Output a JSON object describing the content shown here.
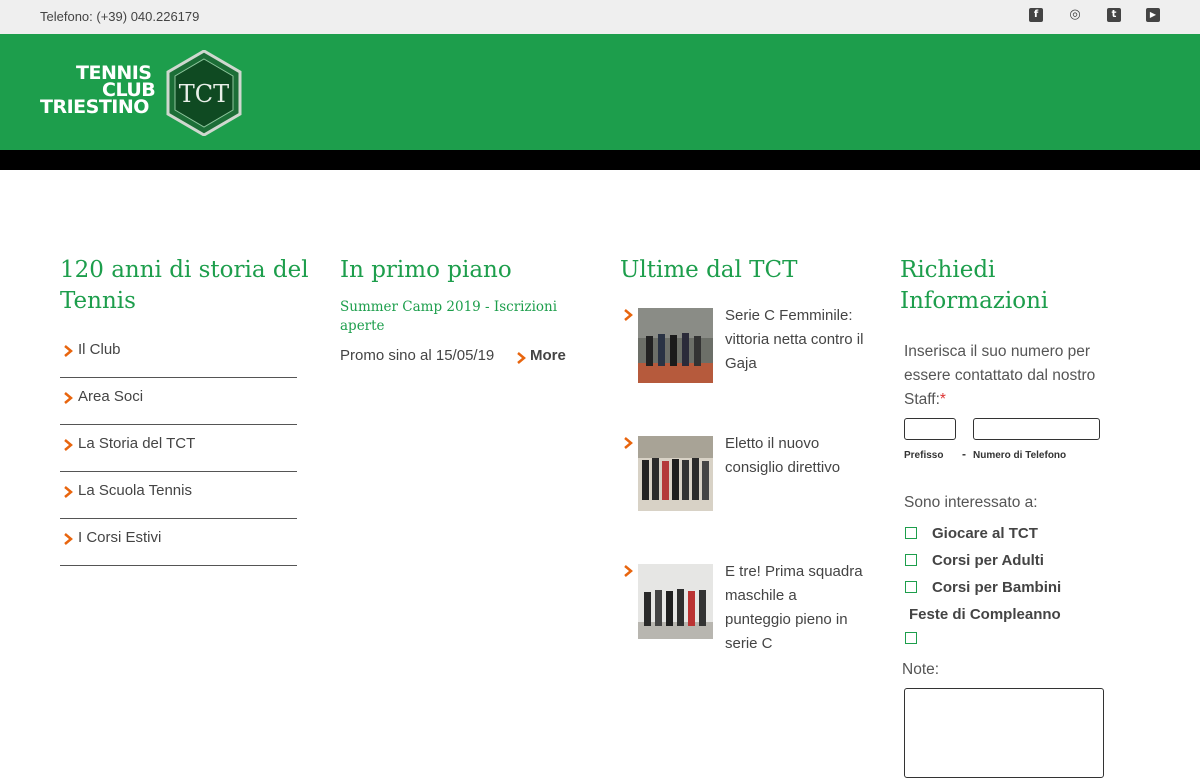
{
  "topbar": {
    "phone": "Telefono: (+39) 040.226179",
    "social": [
      {
        "icon": "facebook-icon",
        "glyph": "f"
      },
      {
        "icon": "instagram-icon",
        "glyph": "◎"
      },
      {
        "icon": "twitter-icon",
        "glyph": "t"
      },
      {
        "icon": "youtube-icon",
        "glyph": "▶"
      }
    ]
  },
  "header": {
    "logo_line1": "TENNIS",
    "logo_line2": "CLUB",
    "logo_line3": "TRIESTINO",
    "logo_emblem": "TCT"
  },
  "club": {
    "title": "120 anni di storia del Tennis",
    "items": [
      "Il Club",
      "Area Soci",
      "La Storia del TCT",
      "La Scuola Tennis",
      "I Corsi Estivi"
    ]
  },
  "highlight": {
    "title": "In primo piano",
    "link": "Summer Camp 2019 - Iscrizioni aperte",
    "text": "Promo sino al 15/05/19",
    "more": "More"
  },
  "news": {
    "title": "Ultime dal TCT",
    "items": [
      {
        "text": "Serie C Femminile: vittoria netta contro il Gaja"
      },
      {
        "text": "Eletto il nuovo consiglio direttivo"
      },
      {
        "text": "E tre! Prima squadra maschile a punteggio pieno in serie C"
      }
    ]
  },
  "form": {
    "title": "Richiedi Informazioni",
    "instructions": "Inserisca il suo numero per essere contattato dal nostro Staff:",
    "required_mark": "*",
    "dash": "-",
    "prefix_label": "Prefisso",
    "number_label": "Numero di Telefono",
    "interest_label": "Sono interessato a:",
    "options": [
      "Giocare al TCT",
      "Corsi per Adulti",
      "Corsi per Bambini",
      "Feste di Compleanno"
    ],
    "note_label": "Note:"
  },
  "colors": {
    "brand_green": "#1d9e4c",
    "chevron_orange": "#e8650e"
  }
}
